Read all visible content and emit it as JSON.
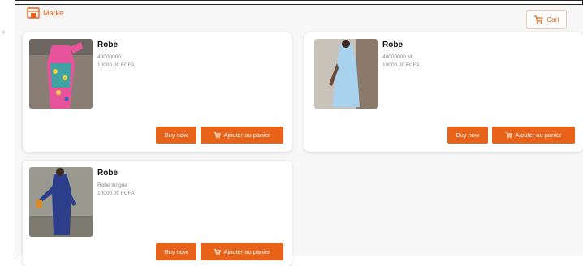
{
  "header": {
    "brand": "Marke",
    "cart_label": "Cart"
  },
  "colors": {
    "accent": "#e9621a",
    "card_bg": "#ffffff",
    "page_bg": "#f7f7f7"
  },
  "icons": {
    "brand": "shop-icon",
    "cart": "cart-icon"
  },
  "products": [
    {
      "title": "Robe",
      "description": "40000000",
      "price": "10000.00 FCFA",
      "buy_label": "Buy now",
      "add_label": "Ajouter au panier"
    },
    {
      "title": "Robe",
      "description": "40000000 M",
      "price": "10000.00 FCFA",
      "buy_label": "Buy now",
      "add_label": "Ajouter au panier"
    },
    {
      "title": "Robe",
      "description": "Robe longue",
      "price": "10000.00 FCFA",
      "buy_label": "Buy now",
      "add_label": "Ajouter au panier"
    }
  ]
}
